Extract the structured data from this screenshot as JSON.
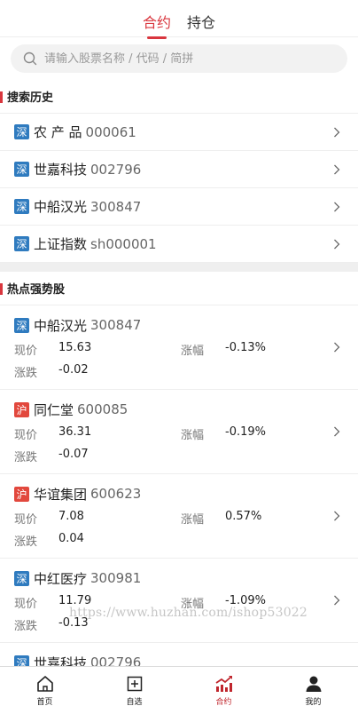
{
  "header": {
    "tabs": [
      {
        "label": "合约",
        "active": true
      },
      {
        "label": "持仓",
        "active": false
      }
    ]
  },
  "search": {
    "placeholder": "请输入股票名称 / 代码 / 简拼"
  },
  "history": {
    "title": "搜索历史",
    "items": [
      {
        "market": "深",
        "name": "农 产 品",
        "code": "000061"
      },
      {
        "market": "深",
        "name": "世嘉科技",
        "code": "002796"
      },
      {
        "market": "深",
        "name": "中船汉光",
        "code": "300847"
      },
      {
        "market": "深",
        "name": "上证指数",
        "code": "sh000001"
      }
    ]
  },
  "hot": {
    "title": "热点强势股",
    "labels": {
      "price": "现价",
      "change_pct": "涨幅",
      "change": "涨跌"
    },
    "items": [
      {
        "market": "深",
        "name": "中船汉光",
        "code": "300847",
        "price": "15.63",
        "change_pct": "-0.13%",
        "change": "-0.02"
      },
      {
        "market": "沪",
        "name": "同仁堂",
        "code": "600085",
        "price": "36.31",
        "change_pct": "-0.19%",
        "change": "-0.07"
      },
      {
        "market": "沪",
        "name": "华谊集团",
        "code": "600623",
        "price": "7.08",
        "change_pct": "0.57%",
        "change": "0.04"
      },
      {
        "market": "深",
        "name": "中红医疗",
        "code": "300981",
        "price": "11.79",
        "change_pct": "-1.09%",
        "change": "-0.13"
      },
      {
        "market": "深",
        "name": "世嘉科技",
        "code": "002796"
      }
    ]
  },
  "watermark": "https://www.huzhan.com/ishop53022",
  "bottom_nav": [
    {
      "label": "首页",
      "icon": "home-icon"
    },
    {
      "label": "自选",
      "icon": "add-favorite-icon"
    },
    {
      "label": "合约",
      "icon": "chart-trend-icon",
      "active": true
    },
    {
      "label": "我的",
      "icon": "user-icon"
    }
  ],
  "colors": {
    "accent": "#d9363e",
    "sz_badge": "#2f7bbf",
    "sh_badge": "#e2483d"
  }
}
